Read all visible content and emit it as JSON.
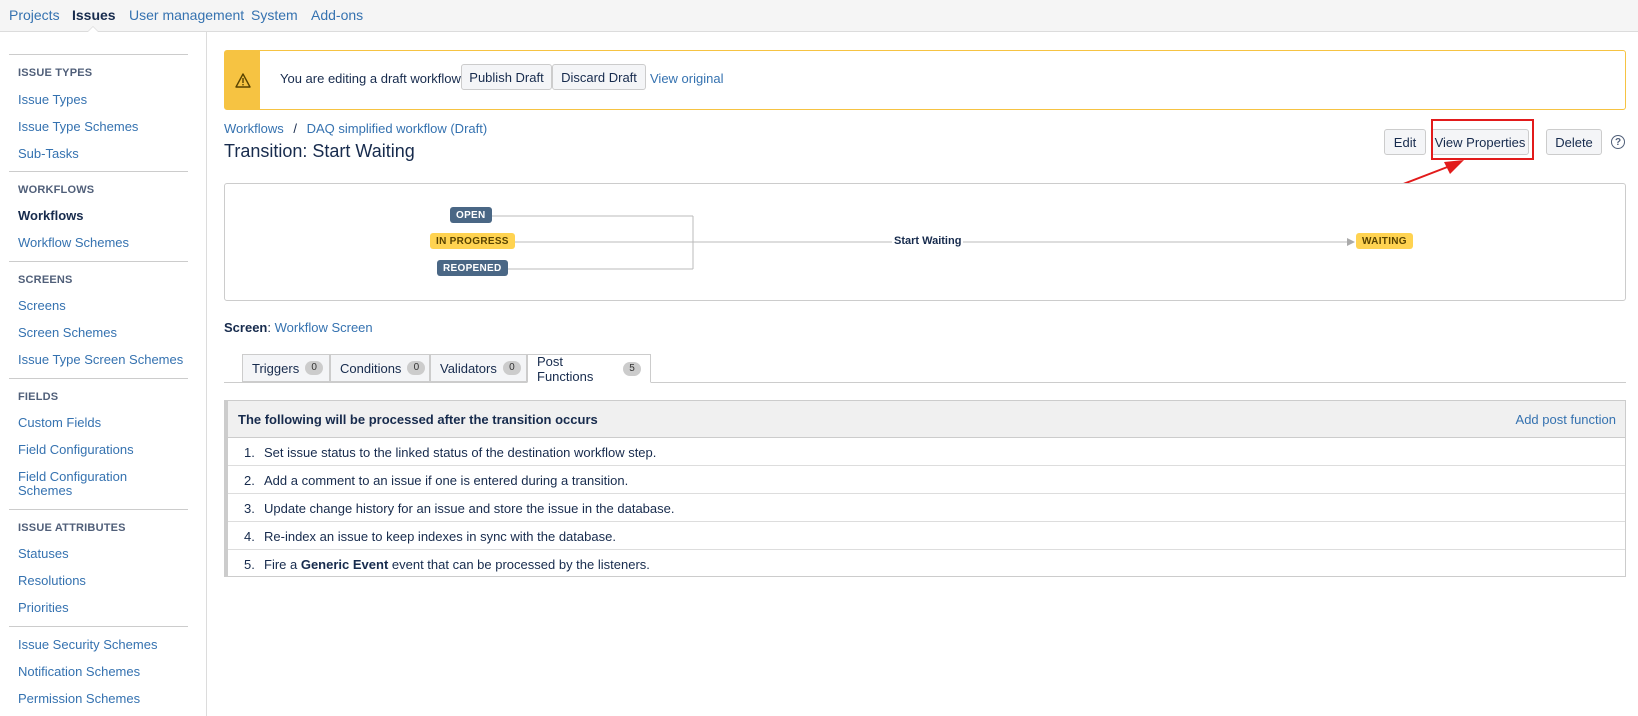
{
  "topnav": {
    "items": [
      {
        "label": "Projects"
      },
      {
        "label": "Issues"
      },
      {
        "label": "User management"
      },
      {
        "label": "System"
      },
      {
        "label": "Add-ons"
      }
    ]
  },
  "sidebar": {
    "issue_types": {
      "heading": "ISSUE TYPES",
      "items": [
        "Issue Types",
        "Issue Type Schemes",
        "Sub-Tasks"
      ]
    },
    "workflows": {
      "heading": "WORKFLOWS",
      "items": [
        "Workflows",
        "Workflow Schemes"
      ]
    },
    "screens": {
      "heading": "SCREENS",
      "items": [
        "Screens",
        "Screen Schemes",
        "Issue Type Screen Schemes"
      ]
    },
    "fields": {
      "heading": "FIELDS",
      "items": [
        "Custom Fields",
        "Field Configurations",
        "Field Configuration",
        "Schemes"
      ]
    },
    "issue_attributes": {
      "heading": "ISSUE ATTRIBUTES",
      "items": [
        "Statuses",
        "Resolutions",
        "Priorities"
      ]
    },
    "schemes": {
      "items": [
        "Issue Security Schemes",
        "Notification Schemes",
        "Permission Schemes"
      ]
    }
  },
  "warning": {
    "text": "You are editing a draft workflow.",
    "publish_label": "Publish Draft",
    "discard_label": "Discard Draft",
    "view_original": "View original"
  },
  "breadcrumb": {
    "root": "Workflows",
    "sep": "/",
    "current": "DAQ simplified workflow (Draft)"
  },
  "page": {
    "title": "Transition: Start Waiting",
    "edit_label": "Edit",
    "view_properties_label": "View Properties",
    "delete_label": "Delete",
    "help_glyph": "?"
  },
  "diagram": {
    "from_statuses": [
      "OPEN",
      "IN PROGRESS",
      "REOPENED"
    ],
    "transition": "Start Waiting",
    "to_status": "WAITING"
  },
  "screen": {
    "label": "Screen",
    "colon": ":",
    "value": "Workflow Screen"
  },
  "tabs": [
    {
      "label": "Triggers",
      "count": "0"
    },
    {
      "label": "Conditions",
      "count": "0"
    },
    {
      "label": "Validators",
      "count": "0"
    },
    {
      "label": "Post Functions",
      "count": "5"
    }
  ],
  "post_functions": {
    "header": "The following will be processed after the transition occurs",
    "add_label": "Add post function",
    "rows": [
      {
        "num": "1.",
        "text": "Set issue status to the linked status of the destination workflow step."
      },
      {
        "num": "2.",
        "text": "Add a comment to an issue if one is entered during a transition."
      },
      {
        "num": "3.",
        "text": "Update change history for an issue and store the issue in the database."
      },
      {
        "num": "4.",
        "text": "Re-index an issue to keep indexes in sync with the database."
      },
      {
        "num": "5.",
        "pre": "Fire a ",
        "bold": "Generic Event",
        "post": " event that can be processed by the listeners."
      }
    ]
  },
  "colors": {
    "link": "#3572b0",
    "warning": "#f6c342",
    "status_blue": "#4a6785",
    "status_yellow": "#ffd351",
    "annotation_red": "#e21b1b"
  }
}
